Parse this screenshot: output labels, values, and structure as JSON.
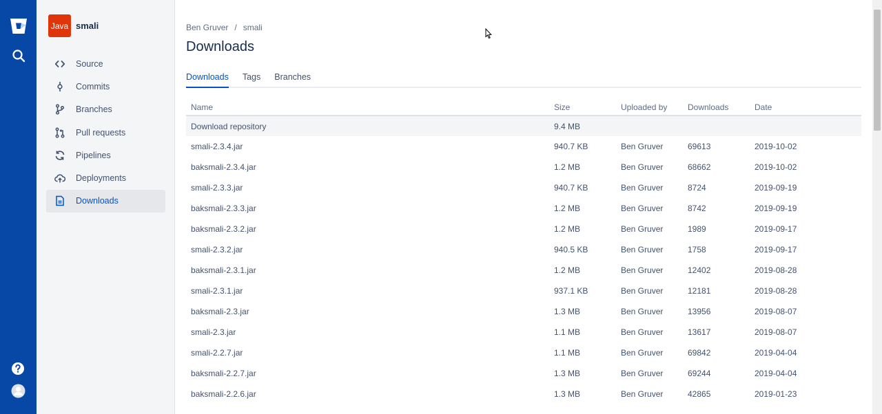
{
  "rail": {
    "logo": "bitbucket-logo-icon",
    "search": "search-icon",
    "help": "help-icon",
    "profile": "user-avatar-icon"
  },
  "repo": {
    "badge": "Java",
    "name": "smali",
    "badge_color": "#de350b"
  },
  "sidebar": {
    "items": [
      {
        "label": "Source",
        "icon": "code-icon"
      },
      {
        "label": "Commits",
        "icon": "commit-icon"
      },
      {
        "label": "Branches",
        "icon": "branch-icon"
      },
      {
        "label": "Pull requests",
        "icon": "pull-request-icon"
      },
      {
        "label": "Pipelines",
        "icon": "pipelines-icon"
      },
      {
        "label": "Deployments",
        "icon": "deployments-icon"
      },
      {
        "label": "Downloads",
        "icon": "downloads-icon"
      }
    ],
    "active": "Downloads"
  },
  "breadcrumb": {
    "owner": "Ben Gruver",
    "separator": "/",
    "repo": "smali"
  },
  "page_title": "Downloads",
  "tabs": [
    {
      "label": "Downloads"
    },
    {
      "label": "Tags"
    },
    {
      "label": "Branches"
    }
  ],
  "table": {
    "headers": {
      "name": "Name",
      "size": "Size",
      "uploaded_by": "Uploaded by",
      "downloads": "Downloads",
      "date": "Date"
    },
    "repo_row": {
      "name": "Download repository",
      "size": "9.4 MB"
    },
    "rows": [
      {
        "name": "smali-2.3.4.jar",
        "size": "940.7 KB",
        "uploaded_by": "Ben Gruver",
        "downloads": "69613",
        "date": "2019-10-02"
      },
      {
        "name": "baksmali-2.3.4.jar",
        "size": "1.2 MB",
        "uploaded_by": "Ben Gruver",
        "downloads": "68662",
        "date": "2019-10-02"
      },
      {
        "name": "smali-2.3.3.jar",
        "size": "940.7 KB",
        "uploaded_by": "Ben Gruver",
        "downloads": "8724",
        "date": "2019-09-19"
      },
      {
        "name": "baksmali-2.3.3.jar",
        "size": "1.2 MB",
        "uploaded_by": "Ben Gruver",
        "downloads": "8742",
        "date": "2019-09-19"
      },
      {
        "name": "baksmali-2.3.2.jar",
        "size": "1.2 MB",
        "uploaded_by": "Ben Gruver",
        "downloads": "1989",
        "date": "2019-09-17"
      },
      {
        "name": "smali-2.3.2.jar",
        "size": "940.5 KB",
        "uploaded_by": "Ben Gruver",
        "downloads": "1758",
        "date": "2019-09-17"
      },
      {
        "name": "baksmali-2.3.1.jar",
        "size": "1.2 MB",
        "uploaded_by": "Ben Gruver",
        "downloads": "12402",
        "date": "2019-08-28"
      },
      {
        "name": "smali-2.3.1.jar",
        "size": "937.1 KB",
        "uploaded_by": "Ben Gruver",
        "downloads": "12181",
        "date": "2019-08-28"
      },
      {
        "name": "baksmali-2.3.jar",
        "size": "1.3 MB",
        "uploaded_by": "Ben Gruver",
        "downloads": "13956",
        "date": "2019-08-07"
      },
      {
        "name": "smali-2.3.jar",
        "size": "1.1 MB",
        "uploaded_by": "Ben Gruver",
        "downloads": "13617",
        "date": "2019-08-07"
      },
      {
        "name": "smali-2.2.7.jar",
        "size": "1.1 MB",
        "uploaded_by": "Ben Gruver",
        "downloads": "69842",
        "date": "2019-04-04"
      },
      {
        "name": "baksmali-2.2.7.jar",
        "size": "1.3 MB",
        "uploaded_by": "Ben Gruver",
        "downloads": "69244",
        "date": "2019-04-04"
      },
      {
        "name": "baksmali-2.2.6.jar",
        "size": "1.3 MB",
        "uploaded_by": "Ben Gruver",
        "downloads": "42865",
        "date": "2019-01-23"
      }
    ]
  },
  "colors": {
    "rail": "#0747a6",
    "accent": "#0052cc",
    "sidebar_bg": "#f4f5f7"
  }
}
